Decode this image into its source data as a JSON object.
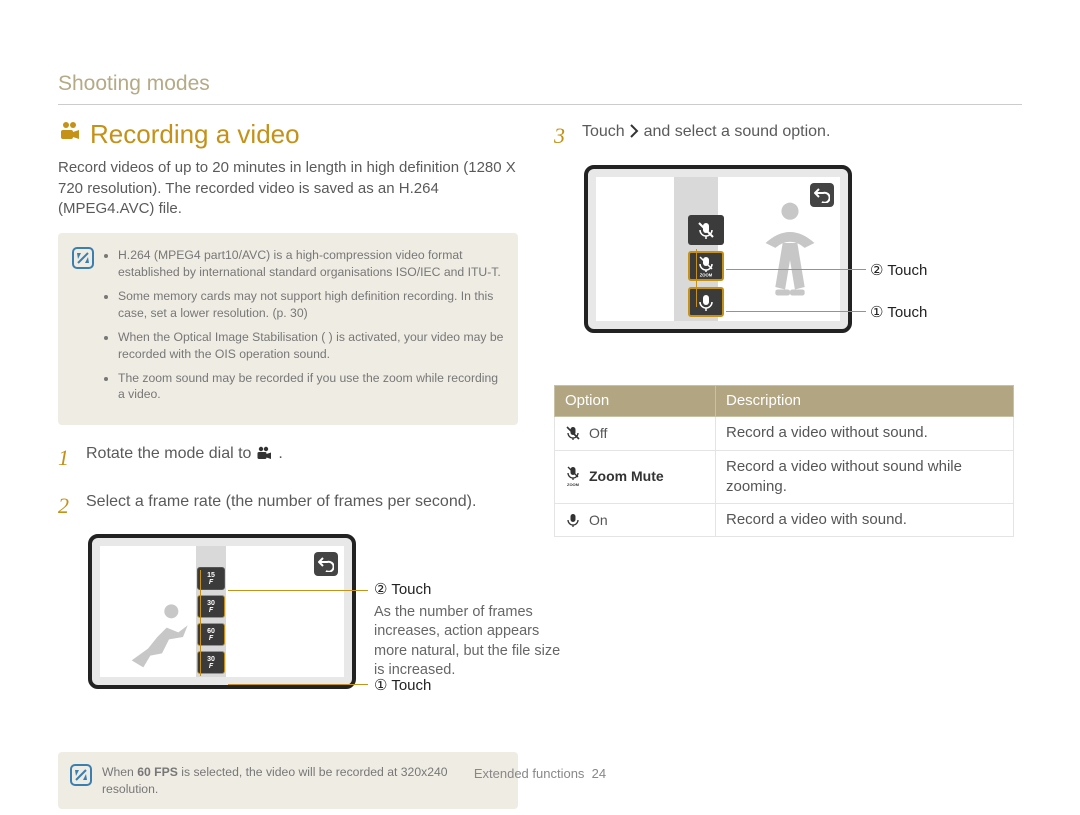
{
  "header": {
    "section": "Shooting modes"
  },
  "title": "Recording a video",
  "intro": "Record videos of up to 20 minutes in length in high definition (1280 X 720 resolution). The recorded video is saved as an H.264 (MPEG4.AVC) file.",
  "note_bullets": [
    "H.264 (MPEG4 part10/AVC) is a high-compression video format established by international standard organisations ISO/IEC and ITU-T.",
    "Some memory cards may not support high definition recording. In this case, set a lower resolution. (p. 30)",
    "When the Optical Image Stabilisation (      ) is activated, your video may be recorded with the OIS operation sound.",
    "The zoom sound may be recorded if you use the zoom while recording a video."
  ],
  "steps": {
    "s1": {
      "num": "1",
      "text_a": "Rotate the mode dial to ",
      "text_b": "."
    },
    "s2": {
      "num": "2",
      "text": "Select a frame rate (the number of frames per second)."
    },
    "s3": {
      "num": "3",
      "text_a": "Touch ",
      "text_b": " and select a sound option."
    }
  },
  "frame_diagram": {
    "options": [
      "15",
      "30",
      "60",
      "30"
    ],
    "callout2_label": "② Touch",
    "callout2_desc": "As the number of frames increases, action appears more natural, but the file size is increased.",
    "callout1_label": "① Touch"
  },
  "fps_note_parts": {
    "a": "When ",
    "b": "60 FPS",
    "c": " is selected, the video will be recorded at 320x240 resolution."
  },
  "sound_diagram": {
    "callout2_label": "② Touch",
    "callout1_label": "① Touch"
  },
  "table": {
    "head_option": "Option",
    "head_desc": "Description",
    "rows": [
      {
        "label": "Off",
        "desc": "Record a video without sound."
      },
      {
        "label": "Zoom Mute",
        "desc": "Record a video without sound while zooming."
      },
      {
        "label": "On",
        "desc": "Record a video with sound."
      }
    ]
  },
  "footer": {
    "label": "Extended functions",
    "page": "24"
  }
}
